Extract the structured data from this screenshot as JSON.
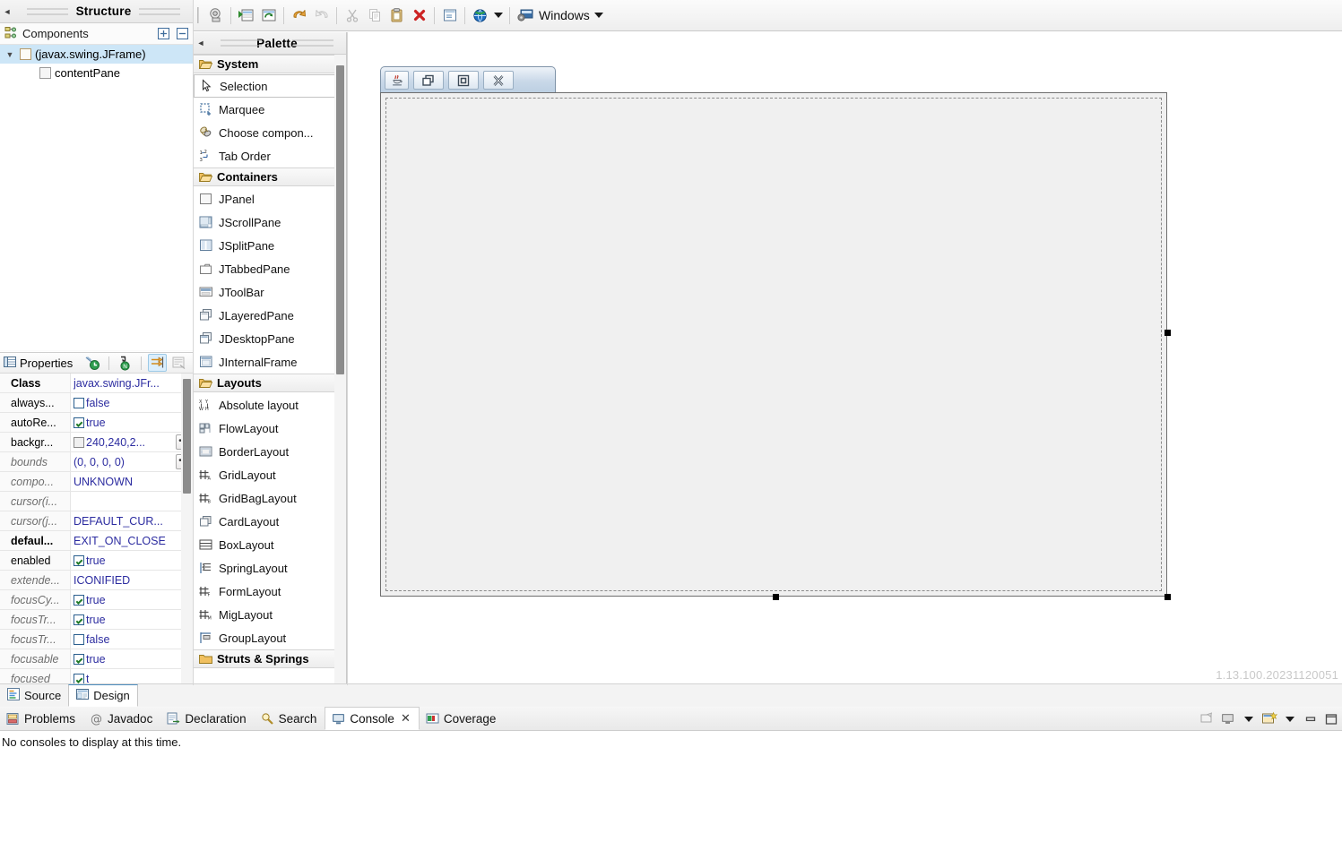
{
  "toolbar": {
    "buttons": [
      {
        "name": "open-type-icon",
        "label": "Open Type"
      },
      {
        "name": "new-java-class-icon",
        "label": "New Java Class"
      },
      {
        "name": "refresh-icon",
        "label": "Refresh"
      },
      {
        "name": "undo-icon",
        "label": "Undo"
      },
      {
        "name": "redo-icon",
        "label": "Redo"
      },
      {
        "name": "cut-icon",
        "label": "Cut"
      },
      {
        "name": "copy-icon",
        "label": "Copy"
      },
      {
        "name": "paste-icon",
        "label": "Paste"
      },
      {
        "name": "delete-icon",
        "label": "Delete"
      },
      {
        "name": "test-dialog-icon",
        "label": "Test/Preview"
      },
      {
        "name": "globe-icon",
        "label": "Externalize strings"
      }
    ],
    "look_and_feel": "Windows"
  },
  "structure_view": {
    "tab_title": "Structure",
    "panel_label": "Components",
    "expand_all_tooltip": "Expand All",
    "collapse_all_tooltip": "Collapse All",
    "tree": [
      {
        "label": "(javax.swing.JFrame)",
        "selected": true,
        "depth": 0,
        "expanded": true
      },
      {
        "label": "contentPane",
        "selected": false,
        "depth": 1,
        "expanded": false
      }
    ]
  },
  "properties_view": {
    "title": "Properties",
    "tools": [
      {
        "name": "restore-default-icon",
        "active": false
      },
      {
        "name": "show-advanced-icon",
        "active": false
      },
      {
        "name": "show-events-icon",
        "active": true
      },
      {
        "name": "goto-definition-icon",
        "active": false
      }
    ],
    "rows": [
      {
        "name": "Class",
        "style": "bold",
        "value": "javax.swing.JFr...",
        "widget": "none",
        "ellipsis": false
      },
      {
        "name": "always...",
        "style": "normal",
        "value": "false",
        "widget": "checkbox-empty",
        "ellipsis": false
      },
      {
        "name": "autoRe...",
        "style": "normal",
        "value": "true",
        "widget": "checkbox-checked",
        "ellipsis": false
      },
      {
        "name": "backgr...",
        "style": "normal",
        "value": "240,240,2...",
        "widget": "color-swatch",
        "ellipsis": true
      },
      {
        "name": "bounds",
        "style": "italic",
        "value": "(0, 0, 0, 0)",
        "widget": "none",
        "ellipsis": true
      },
      {
        "name": "compo...",
        "style": "italic",
        "value": "UNKNOWN",
        "widget": "none",
        "ellipsis": false
      },
      {
        "name": "cursor(i...",
        "style": "italic",
        "value": "",
        "widget": "none",
        "ellipsis": false
      },
      {
        "name": "cursor(j...",
        "style": "italic",
        "value": "DEFAULT_CUR...",
        "widget": "none",
        "ellipsis": false
      },
      {
        "name": "defaul...",
        "style": "bold",
        "value": "EXIT_ON_CLOSE",
        "widget": "none",
        "ellipsis": false
      },
      {
        "name": "enabled",
        "style": "normal",
        "value": "true",
        "widget": "checkbox-checked",
        "ellipsis": false
      },
      {
        "name": "extende...",
        "style": "italic",
        "value": "ICONIFIED",
        "widget": "none",
        "ellipsis": false
      },
      {
        "name": "focusCy...",
        "style": "italic",
        "value": "true",
        "widget": "checkbox-checked",
        "ellipsis": false
      },
      {
        "name": "focusTr...",
        "style": "italic",
        "value": "true",
        "widget": "checkbox-checked",
        "ellipsis": false
      },
      {
        "name": "focusTr...",
        "style": "italic",
        "value": "false",
        "widget": "checkbox-empty",
        "ellipsis": false
      },
      {
        "name": "focusable",
        "style": "italic",
        "value": "true",
        "widget": "checkbox-checked",
        "ellipsis": false
      },
      {
        "name": "focused",
        "style": "italic",
        "value": "t",
        "widget": "checkbox-checked",
        "ellipsis": false
      }
    ]
  },
  "palette": {
    "tab_title": "Palette",
    "categories": [
      {
        "label": "System",
        "items": [
          {
            "label": "Selection",
            "icon": "cursor-arrow-icon",
            "selected": true
          },
          {
            "label": "Marquee",
            "icon": "marquee-icon",
            "selected": false
          },
          {
            "label": "Choose compon...",
            "icon": "choose-component-icon",
            "selected": false
          },
          {
            "label": "Tab Order",
            "icon": "tab-order-icon",
            "selected": false
          }
        ]
      },
      {
        "label": "Containers",
        "items": [
          {
            "label": "JPanel",
            "icon": "jpanel-icon",
            "selected": false
          },
          {
            "label": "JScrollPane",
            "icon": "jscrollpane-icon",
            "selected": false
          },
          {
            "label": "JSplitPane",
            "icon": "jsplitpane-icon",
            "selected": false
          },
          {
            "label": "JTabbedPane",
            "icon": "jtabbedpane-icon",
            "selected": false
          },
          {
            "label": "JToolBar",
            "icon": "jtoolbar-icon",
            "selected": false
          },
          {
            "label": "JLayeredPane",
            "icon": "jlayeredpane-icon",
            "selected": false
          },
          {
            "label": "JDesktopPane",
            "icon": "jdesktoppane-icon",
            "selected": false
          },
          {
            "label": "JInternalFrame",
            "icon": "jinternalframe-icon",
            "selected": false
          }
        ]
      },
      {
        "label": "Layouts",
        "items": [
          {
            "label": "Absolute layout",
            "icon": "absolute-layout-icon",
            "selected": false
          },
          {
            "label": "FlowLayout",
            "icon": "flowlayout-icon",
            "selected": false
          },
          {
            "label": "BorderLayout",
            "icon": "borderlayout-icon",
            "selected": false
          },
          {
            "label": "GridLayout",
            "icon": "gridlayout-icon",
            "selected": false
          },
          {
            "label": "GridBagLayout",
            "icon": "gridbaglayout-icon",
            "selected": false
          },
          {
            "label": "CardLayout",
            "icon": "cardlayout-icon",
            "selected": false
          },
          {
            "label": "BoxLayout",
            "icon": "boxlayout-icon",
            "selected": false
          },
          {
            "label": "SpringLayout",
            "icon": "springlayout-icon",
            "selected": false
          },
          {
            "label": "FormLayout",
            "icon": "formlayout-icon",
            "selected": false
          },
          {
            "label": "MigLayout",
            "icon": "miglayout-icon",
            "selected": false
          },
          {
            "label": "GroupLayout",
            "icon": "grouplayout-icon",
            "selected": false
          }
        ]
      },
      {
        "label": "Struts & Springs",
        "items": []
      }
    ]
  },
  "canvas": {
    "window_buttons": [
      {
        "name": "java-app-icon",
        "glyph": "app"
      },
      {
        "name": "restore-icon",
        "glyph": "restore"
      },
      {
        "name": "maximize-icon",
        "glyph": "maximize"
      },
      {
        "name": "close-icon",
        "glyph": "close"
      }
    ],
    "content_pane_name": "contentPane",
    "version": "1.13.100.20231120051"
  },
  "editor_tabs": [
    {
      "label": "Source",
      "icon": "source-icon",
      "active": false
    },
    {
      "label": "Design",
      "icon": "design-icon",
      "active": true
    }
  ],
  "bottom_views": {
    "tabs": [
      {
        "label": "Problems",
        "icon": "problems-icon",
        "active": false,
        "closable": false
      },
      {
        "label": "Javadoc",
        "icon": "javadoc-icon",
        "active": false,
        "closable": false
      },
      {
        "label": "Declaration",
        "icon": "declaration-icon",
        "active": false,
        "closable": false
      },
      {
        "label": "Search",
        "icon": "search-icon",
        "active": false,
        "closable": false
      },
      {
        "label": "Console",
        "icon": "console-icon",
        "active": true,
        "closable": true
      },
      {
        "label": "Coverage",
        "icon": "coverage-icon",
        "active": false,
        "closable": false
      }
    ],
    "close_glyph": "✕",
    "message": "No consoles to display at this time.",
    "tools": [
      {
        "name": "open-console-icon"
      },
      {
        "name": "display-selected-console-icon"
      },
      {
        "name": "display-selected-console-menu-icon"
      },
      {
        "name": "new-console-view-icon"
      },
      {
        "name": "new-console-view-menu-icon"
      },
      {
        "name": "minimize-view-icon"
      },
      {
        "name": "maximize-view-icon"
      }
    ]
  },
  "colors": {
    "selection_blue": "#cde6f7",
    "value_text": "#2c2ca0",
    "title_bar_blue": "#c9d8e8"
  }
}
